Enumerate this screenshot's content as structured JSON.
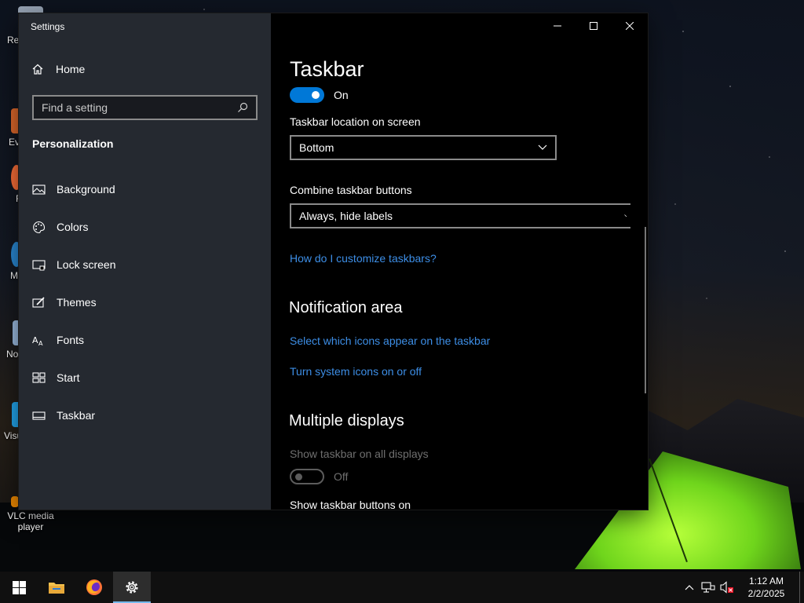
{
  "desktop": {
    "icons": [
      {
        "label": "Rec",
        "icon": "recycle-bin-icon",
        "color": "#9aa7b8"
      },
      {
        "label": "Eve",
        "icon": "everything-icon",
        "color": "#e26a2c"
      },
      {
        "label": "F",
        "icon": "firefox-icon",
        "color": "#ff7139"
      },
      {
        "label": "M",
        "icon": "edge-icon",
        "color": "#2b8cd8"
      },
      {
        "label": "No",
        "icon": "notepad-icon",
        "color": "#9fc0e6"
      },
      {
        "label": "Visu",
        "icon": "vscode-icon",
        "color": "#23a9f2"
      },
      {
        "label": "VLC media player",
        "icon": "vlc-icon",
        "color": "#f08a00"
      }
    ]
  },
  "window": {
    "title": "Settings",
    "caption": {
      "minimize": "minimize-icon",
      "maximize": "maximize-icon",
      "close": "close-icon"
    }
  },
  "sidebar": {
    "home_label": "Home",
    "search_placeholder": "Find a setting",
    "section": "Personalization",
    "items": [
      {
        "label": "Background",
        "icon": "picture-icon"
      },
      {
        "label": "Colors",
        "icon": "palette-icon"
      },
      {
        "label": "Lock screen",
        "icon": "lock-screen-icon"
      },
      {
        "label": "Themes",
        "icon": "brush-icon"
      },
      {
        "label": "Fonts",
        "icon": "font-icon"
      },
      {
        "label": "Start",
        "icon": "start-tiles-icon"
      },
      {
        "label": "Taskbar",
        "icon": "taskbar-icon"
      }
    ]
  },
  "content": {
    "title": "Taskbar",
    "main_toggle": {
      "state": "On",
      "on": true
    },
    "location_label": "Taskbar location on screen",
    "location_value": "Bottom",
    "combine_label": "Combine taskbar buttons",
    "combine_value": "Always, hide labels",
    "help_link": "How do I customize taskbars?",
    "notification_heading": "Notification area",
    "notif_link_1": "Select which icons appear on the taskbar",
    "notif_link_2": "Turn system icons on or off",
    "multi_heading": "Multiple displays",
    "show_all_label": "Show taskbar on all displays",
    "show_all_toggle": {
      "state": "Off",
      "on": false
    },
    "show_buttons_label": "Show taskbar buttons on"
  },
  "taskbar": {
    "buttons": [
      {
        "name": "start-button",
        "icon": "windows-logo-icon"
      },
      {
        "name": "file-explorer-button",
        "icon": "folder-icon"
      },
      {
        "name": "firefox-button",
        "icon": "firefox-icon"
      },
      {
        "name": "settings-button",
        "icon": "gear-icon",
        "active": true
      }
    ],
    "tray": {
      "chevron": "chevron-up-icon",
      "network": "network-icon",
      "volume": "volume-muted-icon"
    },
    "time": "1:12 AM",
    "date": "2/2/2025"
  },
  "colors": {
    "accent": "#0078d7",
    "link": "#3d8ee6",
    "sidebar": "#2c3038",
    "tent": "#8be32a"
  }
}
